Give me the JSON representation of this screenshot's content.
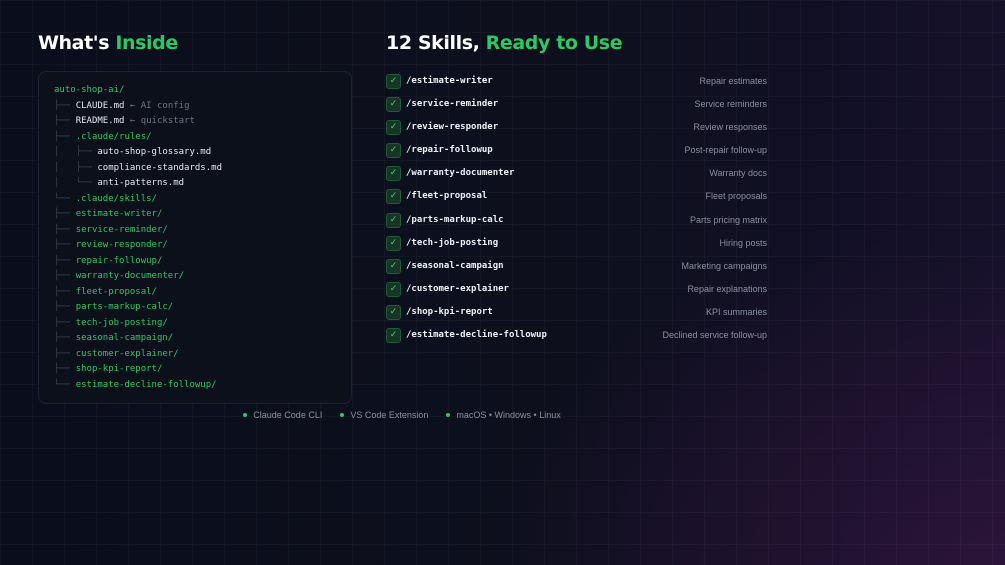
{
  "left_heading": {
    "prefix": "What's",
    "accent": "Inside"
  },
  "right_heading": {
    "prefix": "12 Skills,",
    "accent": "Ready to Use"
  },
  "tree": [
    {
      "prefix": "",
      "name": "auto-shop-ai/",
      "kind": "folder",
      "comment": ""
    },
    {
      "prefix": "├── ",
      "name": "CLAUDE.md",
      "kind": "file",
      "comment": " ← AI config"
    },
    {
      "prefix": "├── ",
      "name": "README.md",
      "kind": "file",
      "comment": " ← quickstart"
    },
    {
      "prefix": "├── ",
      "name": ".claude/rules/",
      "kind": "folder",
      "comment": ""
    },
    {
      "prefix": "│   ├── ",
      "name": "auto-shop-glossary.md",
      "kind": "file",
      "comment": ""
    },
    {
      "prefix": "│   ├── ",
      "name": "compliance-standards.md",
      "kind": "file",
      "comment": ""
    },
    {
      "prefix": "│   └── ",
      "name": "anti-patterns.md",
      "kind": "file",
      "comment": ""
    },
    {
      "prefix": "└── ",
      "name": ".claude/skills/",
      "kind": "folder",
      "comment": ""
    },
    {
      "prefix": "├── ",
      "name": "estimate-writer/",
      "kind": "folder",
      "comment": ""
    },
    {
      "prefix": "├── ",
      "name": "service-reminder/",
      "kind": "folder",
      "comment": ""
    },
    {
      "prefix": "├── ",
      "name": "review-responder/",
      "kind": "folder",
      "comment": ""
    },
    {
      "prefix": "├── ",
      "name": "repair-followup/",
      "kind": "folder",
      "comment": ""
    },
    {
      "prefix": "├── ",
      "name": "warranty-documenter/",
      "kind": "folder",
      "comment": ""
    },
    {
      "prefix": "├── ",
      "name": "fleet-proposal/",
      "kind": "folder",
      "comment": ""
    },
    {
      "prefix": "├── ",
      "name": "parts-markup-calc/",
      "kind": "folder",
      "comment": ""
    },
    {
      "prefix": "├── ",
      "name": "tech-job-posting/",
      "kind": "folder",
      "comment": ""
    },
    {
      "prefix": "├── ",
      "name": "seasonal-campaign/",
      "kind": "folder",
      "comment": ""
    },
    {
      "prefix": "├── ",
      "name": "customer-explainer/",
      "kind": "folder",
      "comment": ""
    },
    {
      "prefix": "├── ",
      "name": "shop-kpi-report/",
      "kind": "folder",
      "comment": ""
    },
    {
      "prefix": "└── ",
      "name": "estimate-decline-followup/",
      "kind": "folder",
      "comment": ""
    }
  ],
  "skills": [
    {
      "check": "✓",
      "command": "/estimate-writer",
      "description": "Repair estimates"
    },
    {
      "check": "✓",
      "command": "/service-reminder",
      "description": "Service reminders"
    },
    {
      "check": "✓",
      "command": "/review-responder",
      "description": "Review responses"
    },
    {
      "check": "✓",
      "command": "/repair-followup",
      "description": "Post-repair follow-up"
    },
    {
      "check": "✓",
      "command": "/warranty-documenter",
      "description": "Warranty docs"
    },
    {
      "check": "✓",
      "command": "/fleet-proposal",
      "description": "Fleet proposals"
    },
    {
      "check": "✓",
      "command": "/parts-markup-calc",
      "description": "Parts pricing matrix"
    },
    {
      "check": "✓",
      "command": "/tech-job-posting",
      "description": "Hiring posts"
    },
    {
      "check": "✓",
      "command": "/seasonal-campaign",
      "description": "Marketing campaigns"
    },
    {
      "check": "✓",
      "command": "/customer-explainer",
      "description": "Repair explanations"
    },
    {
      "check": "✓",
      "command": "/shop-kpi-report",
      "description": "KPI summaries"
    },
    {
      "check": "✓",
      "command": "/estimate-decline-followup",
      "description": "Declined service follow-up"
    }
  ],
  "footer": [
    {
      "label": "Claude Code CLI"
    },
    {
      "label": "VS Code Extension"
    },
    {
      "label": "macOS • Windows • Linux"
    }
  ],
  "colors": {
    "accent": "#2fc766",
    "background": "#0d0f1d",
    "panel": "#0b101b",
    "muted_text": "#8a909d"
  },
  "icons": {
    "check": "check-icon",
    "bullet": "dot-icon"
  }
}
